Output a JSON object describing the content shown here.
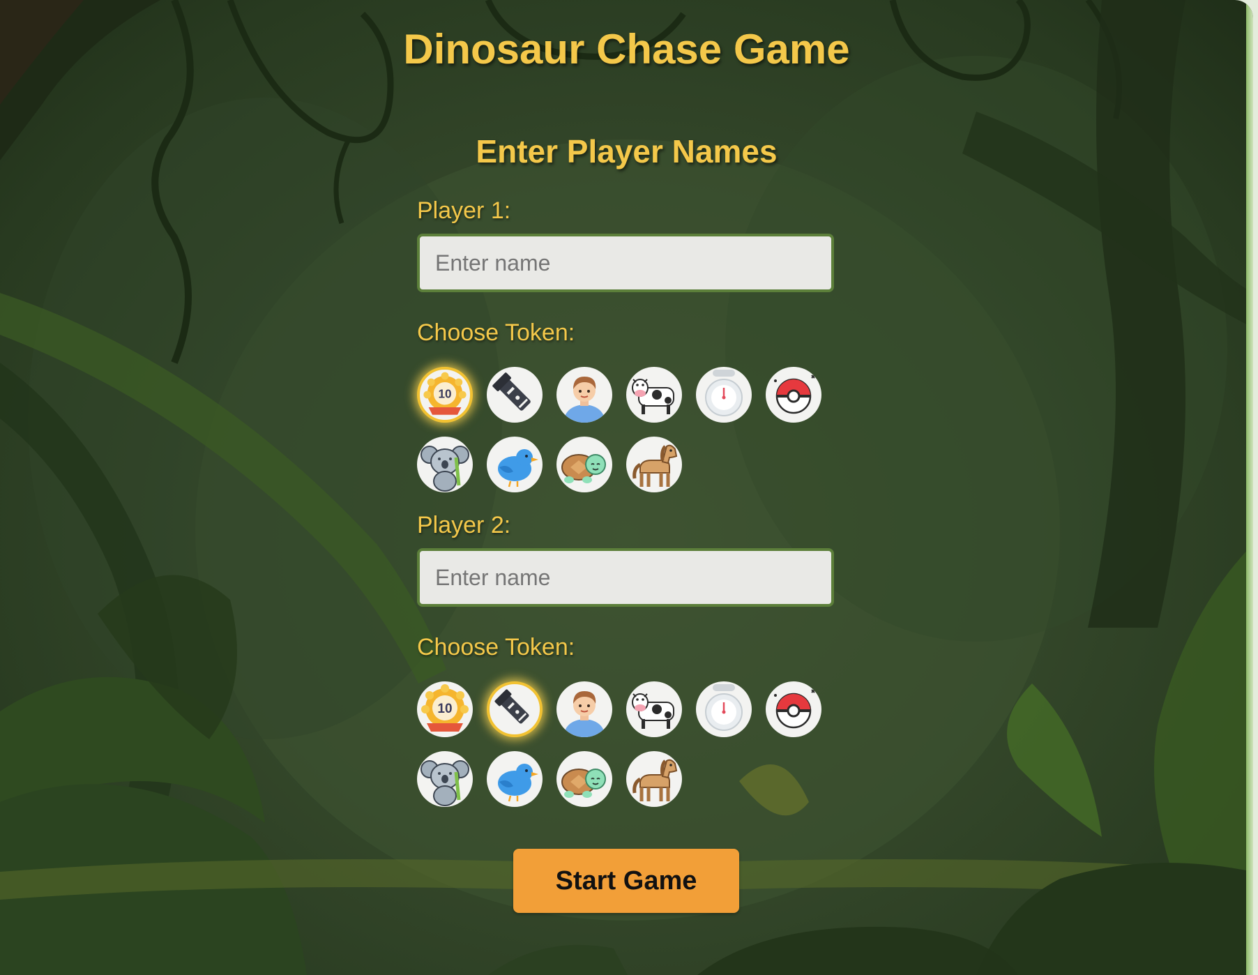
{
  "title": "Dinosaur Chase Game",
  "form": {
    "heading": "Enter Player Names",
    "choose_token_label": "Choose Token:",
    "name_placeholder": "Enter name",
    "start_label": "Start Game"
  },
  "players": [
    {
      "label": "Player 1:",
      "name_value": "",
      "selected_token": "medal-10"
    },
    {
      "label": "Player 2:",
      "name_value": "",
      "selected_token": "flashlight"
    }
  ],
  "tokens": [
    {
      "id": "medal-10",
      "icon": "medal-icon",
      "text": "10"
    },
    {
      "id": "flashlight",
      "icon": "flashlight-icon"
    },
    {
      "id": "boy",
      "icon": "boy-avatar-icon"
    },
    {
      "id": "cow",
      "icon": "cow-icon"
    },
    {
      "id": "stopwatch",
      "icon": "stopwatch-icon"
    },
    {
      "id": "pokeball",
      "icon": "pokeball-icon"
    },
    {
      "id": "koala",
      "icon": "koala-icon"
    },
    {
      "id": "bird",
      "icon": "bird-icon"
    },
    {
      "id": "turtle",
      "icon": "turtle-icon"
    },
    {
      "id": "horse",
      "icon": "horse-icon"
    }
  ],
  "colors": {
    "title": "#f4c84a",
    "input_border": "#5c7f3a",
    "button": "#f29f38",
    "selected_ring": "#f2c232"
  }
}
